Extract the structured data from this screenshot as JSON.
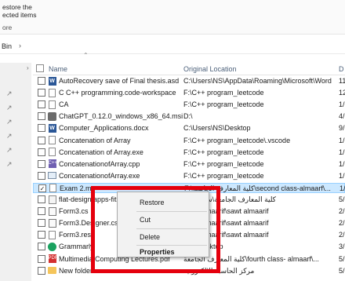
{
  "ribbon": {
    "restore_group_line1": "estore the",
    "restore_group_line2": "ected items",
    "caption": "ore"
  },
  "address": {
    "crumb": "Bin",
    "chevron_icon": "chevron-right-icon"
  },
  "columns": {
    "name": "Name",
    "original_location": "Original Location",
    "date_deleted": "D"
  },
  "files": [
    {
      "name": "AutoRecovery save of Final thesis.asd",
      "location": "C:\\Users\\NS\\AppData\\Roaming\\Microsoft\\Word",
      "date": "11",
      "icon": "word-icon",
      "selected": false
    },
    {
      "name": "C C++ programming.code-workspace",
      "location": "F:\\C++ program_leetcode",
      "date": "12",
      "icon": "document-icon",
      "selected": false
    },
    {
      "name": "CA",
      "location": "F:\\C++ program_leetcode",
      "date": "1/",
      "icon": "document-icon",
      "selected": false
    },
    {
      "name": "ChatGPT_0.12.0_windows_x86_64.msi",
      "location": "D:\\",
      "date": "4/",
      "icon": "installer-icon",
      "selected": false
    },
    {
      "name": "Computer_Applications.docx",
      "location": "C:\\Users\\NS\\Desktop",
      "date": "9/",
      "icon": "word-icon",
      "selected": false
    },
    {
      "name": "Concatenation of Array",
      "location": "F:\\C++ program_leetcode\\.vscode",
      "date": "1/",
      "icon": "document-icon",
      "selected": false
    },
    {
      "name": "Concatenation of Array.exe",
      "location": "F:\\C++ program_leetcode",
      "date": "1/",
      "icon": "document-icon",
      "selected": false
    },
    {
      "name": "ConcatenationofArray.cpp",
      "location": "F:\\C++ program_leetcode",
      "date": "1/",
      "icon": "cpp-icon",
      "selected": false
    },
    {
      "name": "ConcatenationofArray.exe",
      "location": "F:\\C++ program_leetcode",
      "date": "1/",
      "icon": "executable-icon",
      "selected": false
    },
    {
      "name": "Exam 2.m",
      "location": "F:\\كلية المعارف الجامعة\\second class-almaarf\\...",
      "date": "1/",
      "icon": "document-icon",
      "selected": true
    },
    {
      "name": "flat-design apps-fitr",
      "location": "كلية المعارف الجامعة\\سنة تخرج",
      "date": "5/",
      "icon": "dll-icon",
      "selected": false
    },
    {
      "name": "Form3.cs",
      "location": "sawt almaarif\\sawt almaarif",
      "date": "2/",
      "icon": "csharp-icon",
      "selected": false
    },
    {
      "name": "Form3.Designer.cs",
      "location": "sawt almaarif\\sawt almaarif",
      "date": "2/",
      "icon": "csharp-icon",
      "selected": false
    },
    {
      "name": "Form3.resx",
      "location": "sawt almaarif\\sawt almaarif",
      "date": "2/",
      "icon": "document-icon",
      "selected": false
    },
    {
      "name": "Grammarly",
      "location": "\\NS\\Desktop",
      "date": "3/",
      "icon": "app-icon",
      "selected": false
    },
    {
      "name": "Multimedia Computing Lectures.pdf",
      "location": "كلية المعارف الجامعة\\fourth class- almaarf\\...",
      "date": "5/",
      "icon": "pdf-icon",
      "selected": false
    },
    {
      "name": "New folder",
      "location": "مركز الحاسبة الالكترونية",
      "date": "5/",
      "icon": "folder-icon",
      "selected": false
    }
  ],
  "context_menu": {
    "restore": "Restore",
    "cut": "Cut",
    "delete": "Delete",
    "properties": "Properties"
  },
  "colors": {
    "selection": "#cce8ff",
    "annotation": "#e5000d"
  }
}
